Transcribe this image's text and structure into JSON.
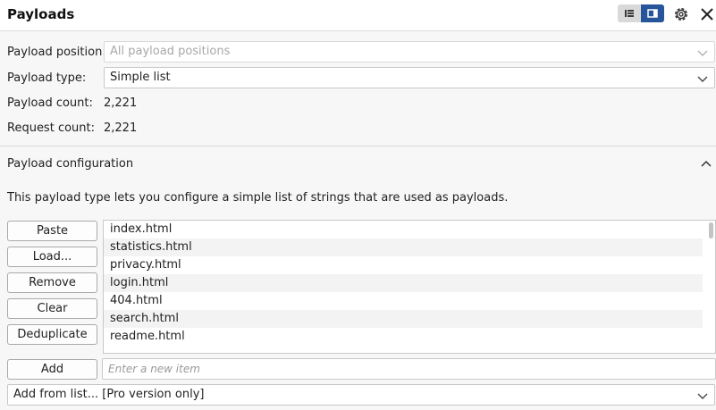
{
  "header": {
    "title": "Payloads",
    "icons": [
      "list-view-icon",
      "detail-view-icon",
      "gear-icon",
      "close-icon"
    ]
  },
  "payload_position": {
    "label": "Payload position:",
    "value": "All payload positions"
  },
  "payload_type": {
    "label": "Payload type:",
    "value": "Simple list"
  },
  "payload_count": {
    "label": "Payload count:",
    "value": "2,221"
  },
  "request_count": {
    "label": "Request count:",
    "value": "2,221"
  },
  "config": {
    "title": "Payload configuration",
    "description": "This payload type lets you configure a simple list of strings that are used as payloads."
  },
  "buttons": {
    "paste": "Paste",
    "load": "Load...",
    "remove": "Remove",
    "clear": "Clear",
    "deduplicate": "Deduplicate",
    "add": "Add"
  },
  "list_items": [
    "index.html",
    "statistics.html",
    "privacy.html",
    "login.html",
    "404.html",
    "search.html",
    "readme.html"
  ],
  "new_item": {
    "placeholder": "Enter a new item"
  },
  "add_from_list": {
    "value": "Add from list... [Pro version only]"
  },
  "colors": {
    "accent": "#27549b",
    "background": "#f7f7f7"
  }
}
